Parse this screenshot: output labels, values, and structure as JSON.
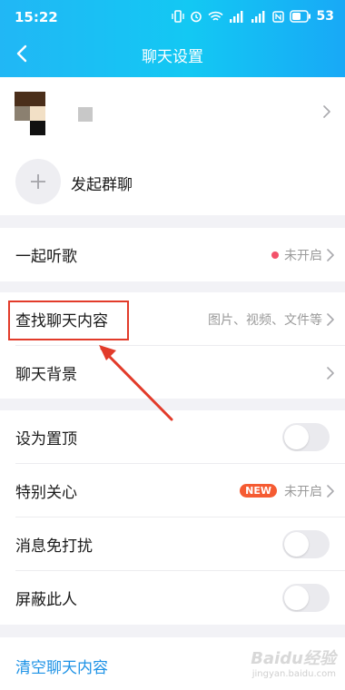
{
  "status_bar": {
    "time": "15:22",
    "battery": "53"
  },
  "nav": {
    "title": "聊天设置"
  },
  "members": {
    "add_label": "发起群聊"
  },
  "listen": {
    "label": "一起听歌",
    "status": "未开启"
  },
  "search": {
    "label": "查找聊天内容",
    "hint": "图片、视频、文件等"
  },
  "background": {
    "label": "聊天背景"
  },
  "pin": {
    "label": "设为置顶",
    "enabled": false
  },
  "special": {
    "label": "特别关心",
    "badge": "NEW",
    "status": "未开启"
  },
  "mute": {
    "label": "消息免打扰",
    "enabled": false
  },
  "block": {
    "label": "屏蔽此人",
    "enabled": false
  },
  "clear": {
    "label": "清空聊天内容"
  },
  "watermark": {
    "main": "Baidu经验",
    "sub": "jingyan.baidu.com"
  },
  "colors": {
    "header_start": "#21b7f5",
    "header_end": "#18a9f6",
    "annotation_red": "#e23b2a",
    "link_blue": "#1d92e6",
    "dot_red": "#f3526a",
    "new_badge": "#f55b32"
  }
}
